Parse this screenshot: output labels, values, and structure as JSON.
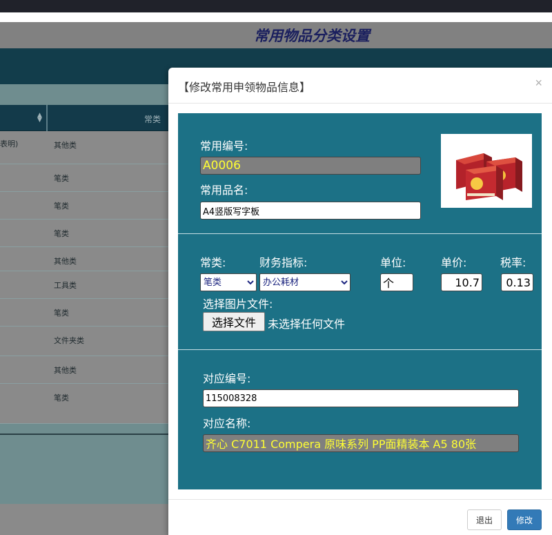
{
  "page": {
    "title": "常用物品分类设置"
  },
  "table": {
    "header_col2": "常类",
    "rows": [
      {
        "c1": "表明)",
        "c2": "其他类"
      },
      {
        "c1": "",
        "c2": "笔类"
      },
      {
        "c1": "",
        "c2": "笔类"
      },
      {
        "c1": "",
        "c2": "笔类"
      },
      {
        "c1": "",
        "c2": "其他类"
      },
      {
        "c1": "",
        "c2": "工具类"
      },
      {
        "c1": "",
        "c2": "笔类"
      },
      {
        "c1": "",
        "c2": "文件夹类"
      },
      {
        "c1": "",
        "c2": "其他类"
      },
      {
        "c1": "",
        "c2": "笔类"
      }
    ]
  },
  "modal": {
    "title": "【修改常用申领物品信息】",
    "close": "×",
    "code_label": "常用编号:",
    "code_value": "A0006",
    "name_label": "常用品名:",
    "name_value": "A4竖版写字板",
    "category_label": "常类:",
    "category_value": "笔类",
    "finance_label": "财务指标:",
    "finance_value": "办公耗材",
    "unit_label": "单位:",
    "unit_value": "个",
    "price_label": "单价:",
    "price_value": "10.7",
    "tax_label": "税率:",
    "tax_value": "0.13",
    "image_label": "选择图片文件:",
    "file_button": "选择文件",
    "file_status": "未选择任何文件",
    "match_code_label": "对应编号:",
    "match_code_value": "115008328",
    "match_name_label": "对应名称:",
    "match_name_value": "齐心 C7011 Compera 原味系列 PP面精装本 A5 80张",
    "exit_button": "退出",
    "modify_button": "修改"
  },
  "colors": {
    "panel": "#1c7186",
    "primary_button": "#337ab7",
    "readonly_text": "#ffff33"
  }
}
